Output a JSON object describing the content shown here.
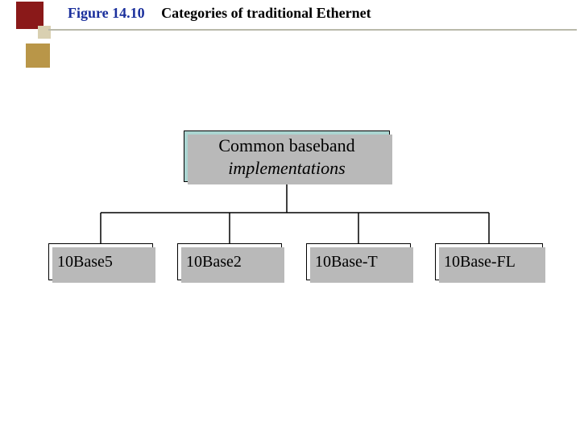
{
  "figure": {
    "label": "Figure 14.10",
    "caption": "Categories of traditional Ethernet"
  },
  "root": {
    "line1": "Common baseband",
    "line2": "implementations"
  },
  "children": {
    "c1": "10Base5",
    "c2": "10Base2",
    "c3": "10Base-T",
    "c4": "10Base-FL"
  },
  "colors": {
    "accent_navy": "#1a2f9c",
    "root_fill": "#abd5d1"
  }
}
